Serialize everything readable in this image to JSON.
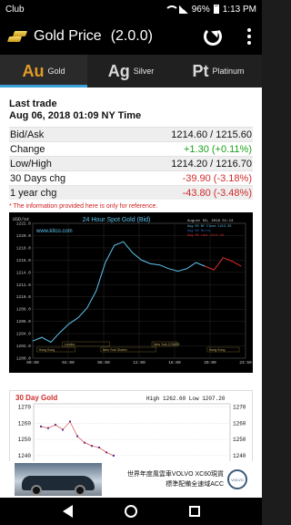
{
  "status_bar": {
    "carrier": "Club",
    "battery": "96%",
    "time": "1:13 PM"
  },
  "app_bar": {
    "title": "Gold Price",
    "version": "(2.0.0)"
  },
  "tabs": [
    {
      "symbol": "Au",
      "label": "Gold",
      "active": true
    },
    {
      "symbol": "Ag",
      "label": "Silver",
      "active": false
    },
    {
      "symbol": "Pt",
      "label": "Platinum",
      "active": false
    }
  ],
  "last_trade": {
    "title": "Last trade",
    "date": "Aug 06, 2018 01:09 NY Time",
    "rows": [
      {
        "label": "Bid/Ask",
        "value": "1214.60 / 1215.60",
        "color": "#111111"
      },
      {
        "label": "Change",
        "value": "+1.30 (+0.11%)",
        "color": "#1ba31b"
      },
      {
        "label": "Low/High",
        "value": "1214.20 / 1216.70",
        "color": "#111111"
      },
      {
        "label": "30 Days chg",
        "value": "-39.90 (-3.18%)",
        "color": "#d02b2b"
      },
      {
        "label": "1 year chg",
        "value": "-43.80 (-3.48%)",
        "color": "#d02b2b"
      }
    ],
    "disclaimer": "* The information provided here is only for reference."
  },
  "chart_24h": {
    "title": "24 Hour Spot Gold (Bid)",
    "unit": "USD/oz",
    "watermark": "www.kitco.com",
    "info_date": "August 06, 2018 01:13",
    "legend": [
      "Aug 03 NY Close 1213.30",
      "Aug 03 Hi/Lo",
      "Aug 06 Last 1214.50"
    ],
    "y_ticks": [
      "1222.0",
      "1220.0",
      "1218.0",
      "1216.0",
      "1214.0",
      "1212.0",
      "1210.0",
      "1208.0",
      "1206.0",
      "1204.0",
      "1202.0",
      "1200.0"
    ],
    "x_ticks": [
      "00:00",
      "04:00",
      "08:00",
      "12:00",
      "16:00",
      "20:00",
      "23:59"
    ],
    "market_labels": [
      "Hong Kong",
      "London",
      "New York Globex",
      "New York COMEX",
      "Hong Kong"
    ],
    "price_by_hour": [
      1202.8,
      1203.4,
      1202.6,
      1204.2,
      1205.6,
      1206.6,
      1208.2,
      1211.0,
      1215.6,
      1218.4,
      1219.0,
      1217.2,
      1216.0,
      1215.4,
      1215.2,
      1214.6,
      1214.2,
      1214.6,
      1215.6,
      1215.0,
      1214.4,
      1216.4,
      1215.8,
      1215.0
    ],
    "line_colors": {
      "day1": "#5fc4ee",
      "day2": "#e02a2a"
    }
  },
  "chart_30d": {
    "title": "30 Day Gold",
    "high_low": "High 1262.60 Low 1207.20",
    "y_ticks": [
      "1270",
      "1260",
      "1250",
      "1240"
    ]
  },
  "ad": {
    "line1": "世界年度風雲車VOLVO XC60現貨",
    "line2": "標準配備全速域ACC",
    "brand": "VOLVO"
  },
  "chart_data": [
    {
      "type": "line",
      "title": "24 Hour Spot Gold (Bid)",
      "ylabel": "USD/oz",
      "x": [
        "00:00",
        "01:00",
        "02:00",
        "03:00",
        "04:00",
        "05:00",
        "06:00",
        "07:00",
        "08:00",
        "09:00",
        "10:00",
        "11:00",
        "12:00",
        "13:00",
        "14:00",
        "15:00",
        "16:00",
        "17:00",
        "18:00",
        "19:00",
        "20:00",
        "21:00",
        "22:00",
        "23:00"
      ],
      "series": [
        {
          "name": "",
          "values": [
            1202.8,
            1203.4,
            1202.6,
            1204.2,
            1205.6,
            1206.6,
            1208.2,
            1211.0,
            1215.6,
            1218.4,
            1219.0,
            1217.2,
            1216.0,
            1215.4,
            1215.2,
            1214.6,
            1214.2,
            1214.6,
            1215.6,
            1215.0,
            1214.4,
            1216.4,
            1215.8,
            1215.0
          ]
        }
      ],
      "ylim": [
        1200,
        1222
      ],
      "grid": true
    },
    {
      "type": "line",
      "title": "30 Day Gold",
      "ylim": [
        1240,
        1270
      ],
      "series": [
        {
          "name": "",
          "values": [
            1258,
            1257,
            1259,
            1256,
            1261,
            1252,
            1248,
            1246,
            1245,
            1242,
            1240
          ]
        }
      ]
    }
  ]
}
